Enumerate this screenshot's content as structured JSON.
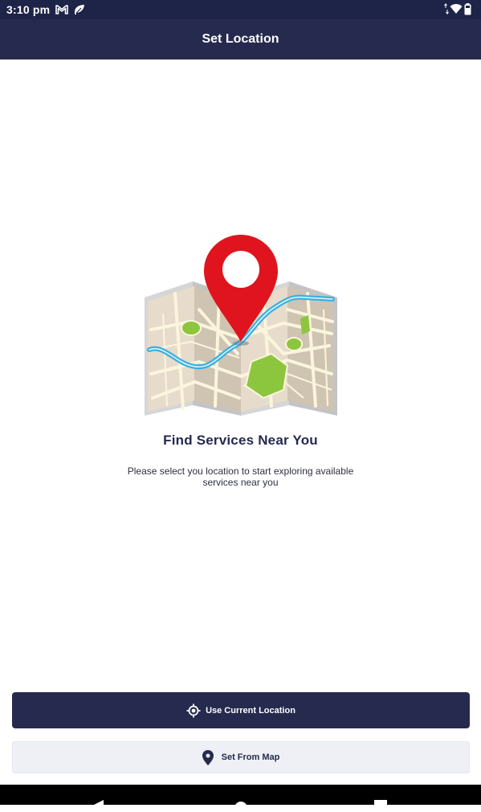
{
  "status_bar": {
    "time": "3:10 pm",
    "icons": [
      "gmail-icon",
      "leaf-icon",
      "data-arrows-icon",
      "wifi-icon",
      "battery-icon"
    ]
  },
  "app_bar": {
    "title": "Set Location"
  },
  "main": {
    "illustration": "map-with-location-pin",
    "heading": "Find Services Near You",
    "description": "Please select you location to start exploring available services near you"
  },
  "actions": {
    "use_current_location": "Use Current Location",
    "set_from_map": "Set From Map"
  },
  "nav_bar": {
    "buttons": [
      "back",
      "home",
      "recents"
    ]
  },
  "colors": {
    "primary": "#252a4e",
    "status_bar": "#1e2447",
    "secondary_button": "#eef0f5",
    "pin_red": "#e0141e",
    "park_green": "#8cc63f",
    "river_blue": "#3ab0e2"
  }
}
